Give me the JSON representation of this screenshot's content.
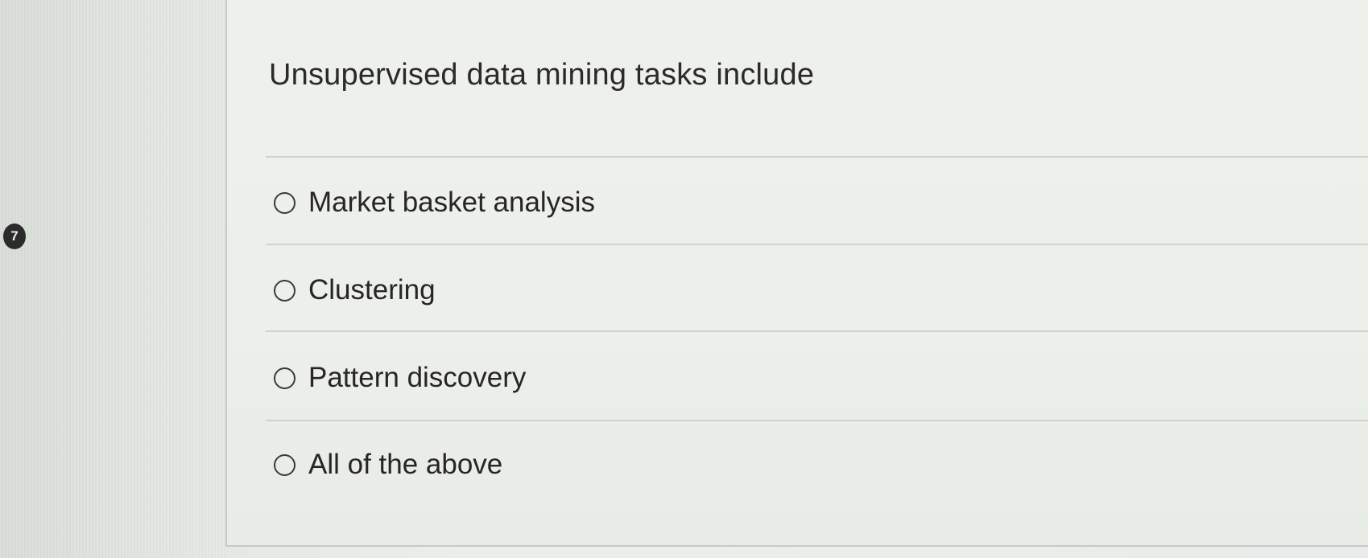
{
  "question": {
    "number": "7",
    "text": "Unsupervised data mining tasks include"
  },
  "options": [
    {
      "label": "Market basket analysis",
      "selected": false
    },
    {
      "label": "Clustering",
      "selected": false
    },
    {
      "label": "Pattern discovery",
      "selected": false
    },
    {
      "label": "All of the above",
      "selected": false
    }
  ]
}
